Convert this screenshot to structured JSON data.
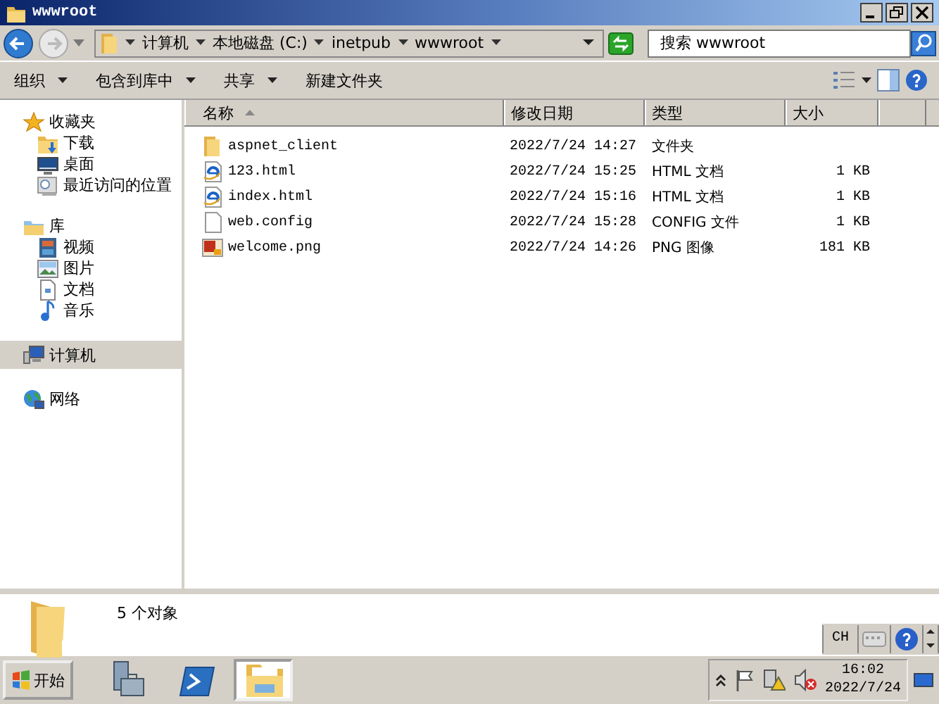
{
  "window": {
    "title": "wwwroot"
  },
  "address": {
    "crumbs": [
      "计算机",
      "本地磁盘 (C:)",
      "inetpub",
      "wwwroot"
    ]
  },
  "search": {
    "placeholder": "搜索 wwwroot"
  },
  "toolbar": [
    {
      "label": "组织",
      "dropdown": true
    },
    {
      "label": "包含到库中",
      "dropdown": true
    },
    {
      "label": "共享",
      "dropdown": true
    },
    {
      "label": "新建文件夹",
      "dropdown": false
    }
  ],
  "sidebar": {
    "groups": [
      {
        "label": "收藏夹",
        "selected": false,
        "children": [
          {
            "label": "下载",
            "selected": false
          },
          {
            "label": "桌面",
            "selected": false
          },
          {
            "label": "最近访问的位置",
            "selected": false
          }
        ]
      },
      {
        "label": "库",
        "selected": false,
        "children": [
          {
            "label": "视频",
            "selected": false
          },
          {
            "label": "图片",
            "selected": false
          },
          {
            "label": "文档",
            "selected": false
          },
          {
            "label": "音乐",
            "selected": false
          }
        ]
      },
      {
        "label": "计算机",
        "selected": true
      },
      {
        "label": "网络",
        "selected": false
      }
    ]
  },
  "table": {
    "columns": [
      "名称",
      "修改日期",
      "类型",
      "大小"
    ],
    "rows": [
      {
        "kind": "folder",
        "name": "aspnet_client",
        "modified": "2022/7/24 14:27",
        "type": "文件夹"
      },
      {
        "kind": "html",
        "name": "123.html",
        "modified": "2022/7/24 15:25",
        "type": "HTML 文档",
        "size": "1 KB"
      },
      {
        "kind": "html",
        "name": "index.html",
        "modified": "2022/7/24 15:16",
        "type": "HTML 文档",
        "size": "1 KB"
      },
      {
        "kind": "config",
        "name": "web.config",
        "modified": "2022/7/24 15:28",
        "type": "CONFIG 文件",
        "size": "1 KB"
      },
      {
        "kind": "png",
        "name": "welcome.png",
        "modified": "2022/7/24 14:26",
        "type": "PNG 图像",
        "size": "181 KB"
      }
    ]
  },
  "status_bar": {
    "text": "5 个对象"
  },
  "language_bar": {
    "label": "CH"
  },
  "taskbar": {
    "start": "开始",
    "tasks": [
      {
        "kind": "server",
        "selected": false
      },
      {
        "kind": "shell",
        "selected": false
      },
      {
        "kind": "explorer",
        "selected": true
      }
    ],
    "clock": {
      "time": "16:02",
      "date": "2022/7/24"
    }
  }
}
